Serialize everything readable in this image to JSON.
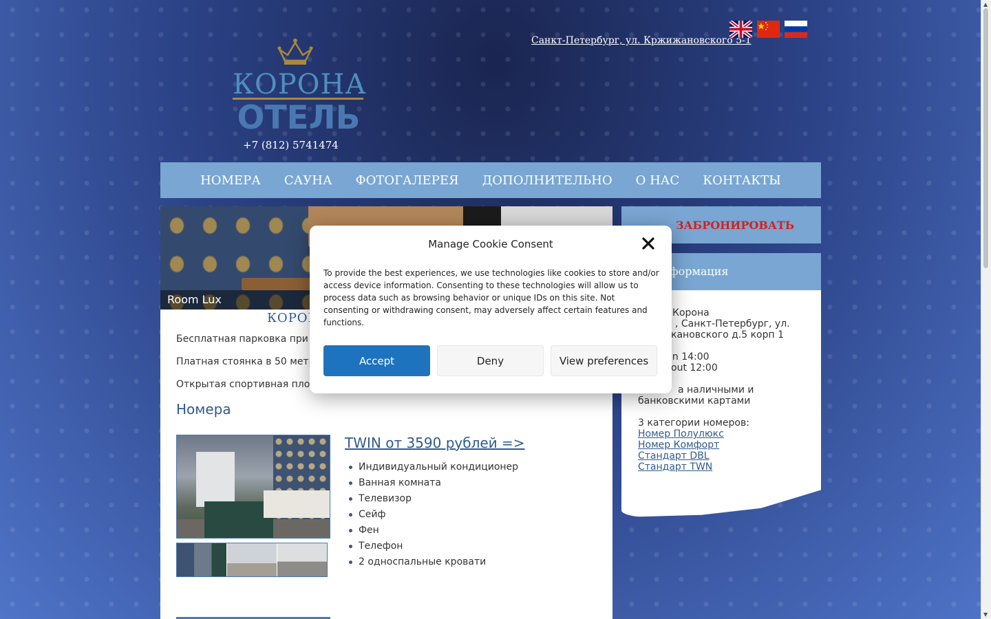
{
  "header": {
    "logo_top": "КОРОНА",
    "logo_bottom": "ОТЕЛЬ",
    "phone": "+7 (812) 5741474",
    "address": "Санкт-Петербург, ул. Кржижановского 5-1",
    "flags": [
      "english-flag",
      "chinese-flag",
      "russian-flag"
    ]
  },
  "nav": {
    "items": [
      "НОМЕРА",
      "САУНА",
      "ФОТОГАЛЕРЕЯ",
      "ДОПОЛНИТЕЛЬНО",
      "О НАС",
      "КОНТАКТЫ"
    ]
  },
  "main": {
    "slide_caption": "Room Lux",
    "hotel_title": "КОРОН",
    "info_lines": [
      "Бесплатная парковка при",
      "Платная стоянка в 50 метр",
      "Открытая спортивная пло"
    ],
    "rooms_heading": "Номера",
    "room_link": "TWIN от 3590 рублей =>",
    "features": [
      "Индивидуальный кондиционер",
      "Ванная комната",
      "Телевизор",
      "Сейф",
      "Фен",
      "Телефон",
      "2 односпальные кровати"
    ]
  },
  "sidebar": {
    "book_label": "ЗАБРОНИРОВАТЬ",
    "info_heading": "ая информация",
    "lines": [
      "Корона",
      ", Санкт-Петербург, ул.",
      "кановского д.5 корп 1",
      "in 14:00",
      "out 12:00",
      "а наличными и",
      "банковскими картами",
      "3 категории номеров:"
    ],
    "links": [
      "Номер Полулюкс",
      "Номер Комфорт",
      "Стандарт DBL",
      "Стандарт TWN"
    ]
  },
  "cookie": {
    "title": "Manage Cookie Consent",
    "text": "To provide the best experiences, we use technologies like cookies to store and/or access device information. Consenting to these technologies will allow us to process data such as browsing behavior or unique IDs on this site. Not consenting or withdrawing consent, may adversely affect certain features and functions.",
    "accept": "Accept",
    "deny": "Deny",
    "preferences": "View preferences"
  },
  "colors": {
    "nav_bg": "#79a6d2",
    "accent": "#1e73be",
    "book_text": "#d81e1e",
    "title_blue": "#2f5a8e"
  }
}
